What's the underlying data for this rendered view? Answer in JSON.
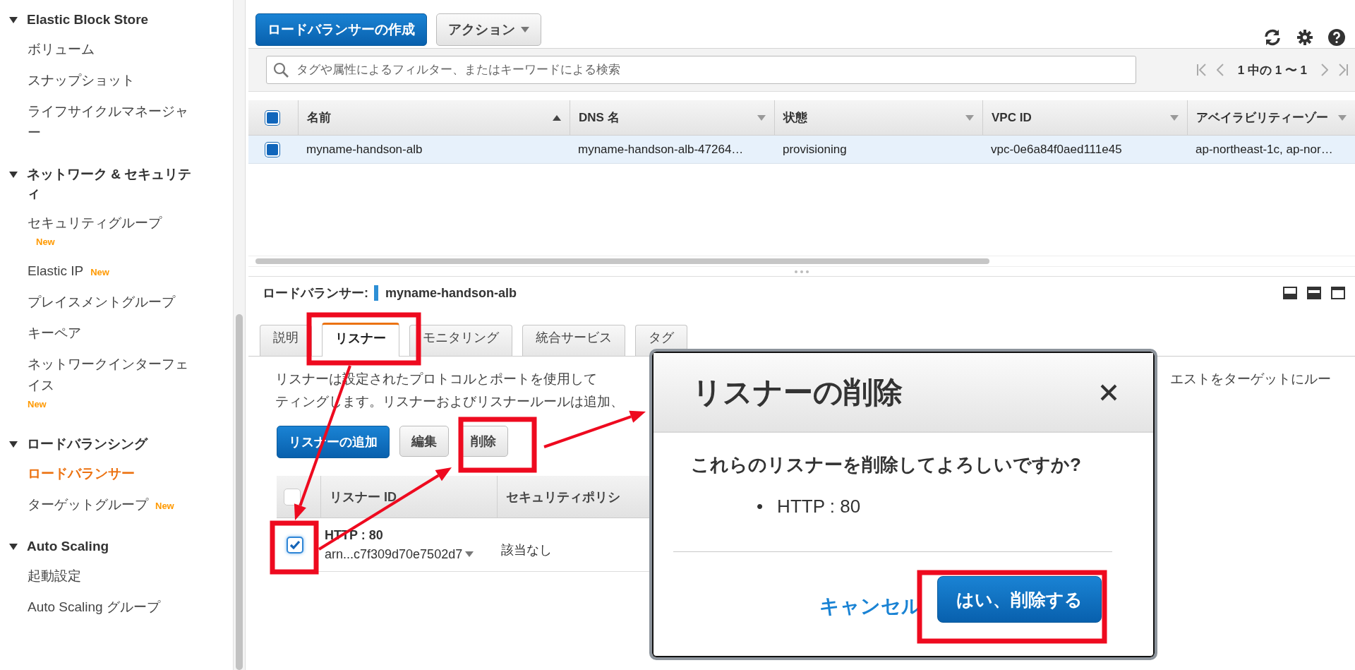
{
  "sidebar": {
    "sections": [
      {
        "title": "Elastic Block Store",
        "expanded": true,
        "items": [
          {
            "label": "ボリューム",
            "selected": false
          },
          {
            "label": "スナップショット",
            "selected": false
          },
          {
            "label": "ライフサイクルマネージャー",
            "selected": false
          }
        ]
      },
      {
        "title": "ネットワーク & セキュリティ",
        "expanded": true,
        "items": [
          {
            "label": "セキュリティグループ",
            "selected": false,
            "badge": "New"
          },
          {
            "label": "Elastic IP",
            "selected": false,
            "badge": "New"
          },
          {
            "label": "プレイスメントグループ",
            "selected": false
          },
          {
            "label": "キーペア",
            "selected": false
          },
          {
            "label": "ネットワークインターフェイス",
            "selected": false,
            "badge": "New"
          }
        ]
      },
      {
        "title": "ロードバランシング",
        "expanded": true,
        "items": [
          {
            "label": "ロードバランサー",
            "selected": true
          },
          {
            "label": "ターゲットグループ",
            "selected": false,
            "badge": "New"
          }
        ]
      },
      {
        "title": "Auto Scaling",
        "expanded": true,
        "items": [
          {
            "label": "起動設定",
            "selected": false
          },
          {
            "label": "Auto Scaling グループ",
            "selected": false
          }
        ]
      }
    ]
  },
  "toolbar": {
    "create_button": "ロードバランサーの作成",
    "actions_button": "アクション"
  },
  "search": {
    "placeholder": "タグや属性によるフィルター、またはキーワードによる検索"
  },
  "pagination": {
    "text": "1 中の 1 〜 1"
  },
  "table": {
    "all_selected": true,
    "columns": [
      {
        "label": "名前",
        "sorted": true
      },
      {
        "label": "DNS 名",
        "sorted": false
      },
      {
        "label": "状態",
        "sorted": false
      },
      {
        "label": "VPC ID",
        "sorted": false
      },
      {
        "label": "アベイラビリティーゾー",
        "sorted": false
      }
    ],
    "rows": [
      {
        "selected": true,
        "cells": [
          "myname-handson-alb",
          "myname-handson-alb-47264…",
          "provisioning",
          "vpc-0e6a84f0aed111e45",
          "ap-northeast-1c, ap-nor…"
        ]
      }
    ]
  },
  "details": {
    "label": "ロードバランサー:",
    "name": "myname-handson-alb",
    "tabs": [
      {
        "label": "説明",
        "selected": false
      },
      {
        "label": "リスナー",
        "selected": true
      },
      {
        "label": "モニタリング",
        "selected": false
      },
      {
        "label": "統合サービス",
        "selected": false
      },
      {
        "label": "タグ",
        "selected": false
      }
    ],
    "description": {
      "line_1_start": "リスナーは設定されたプロトコルとポートを使用して",
      "line_1_end": "エストをターゲットにルー",
      "line_2": "ティングします。リスナーおよびリスナールールは追加、"
    },
    "buttons": [
      {
        "label": "リスナーの追加",
        "kind": "primary"
      },
      {
        "label": "編集",
        "kind": "secondary"
      },
      {
        "label": "削除",
        "kind": "secondary"
      }
    ],
    "listener_table": {
      "all_selected": false,
      "columns": [
        "リスナー ID",
        "セキュリティポリシ"
      ],
      "rows": [
        {
          "selected": true,
          "protocol": "HTTP : 80",
          "arn": "arn...c7f309d70e7502d7",
          "policy": "該当なし"
        }
      ]
    }
  },
  "dialog": {
    "title": "リスナーの削除",
    "question": "これらのリスナーを削除してよろしいですか?",
    "items": [
      {
        "marker": "•",
        "text": "HTTP : 80"
      }
    ],
    "cancel": "キャンセル",
    "confirm": "はい、削除する"
  }
}
